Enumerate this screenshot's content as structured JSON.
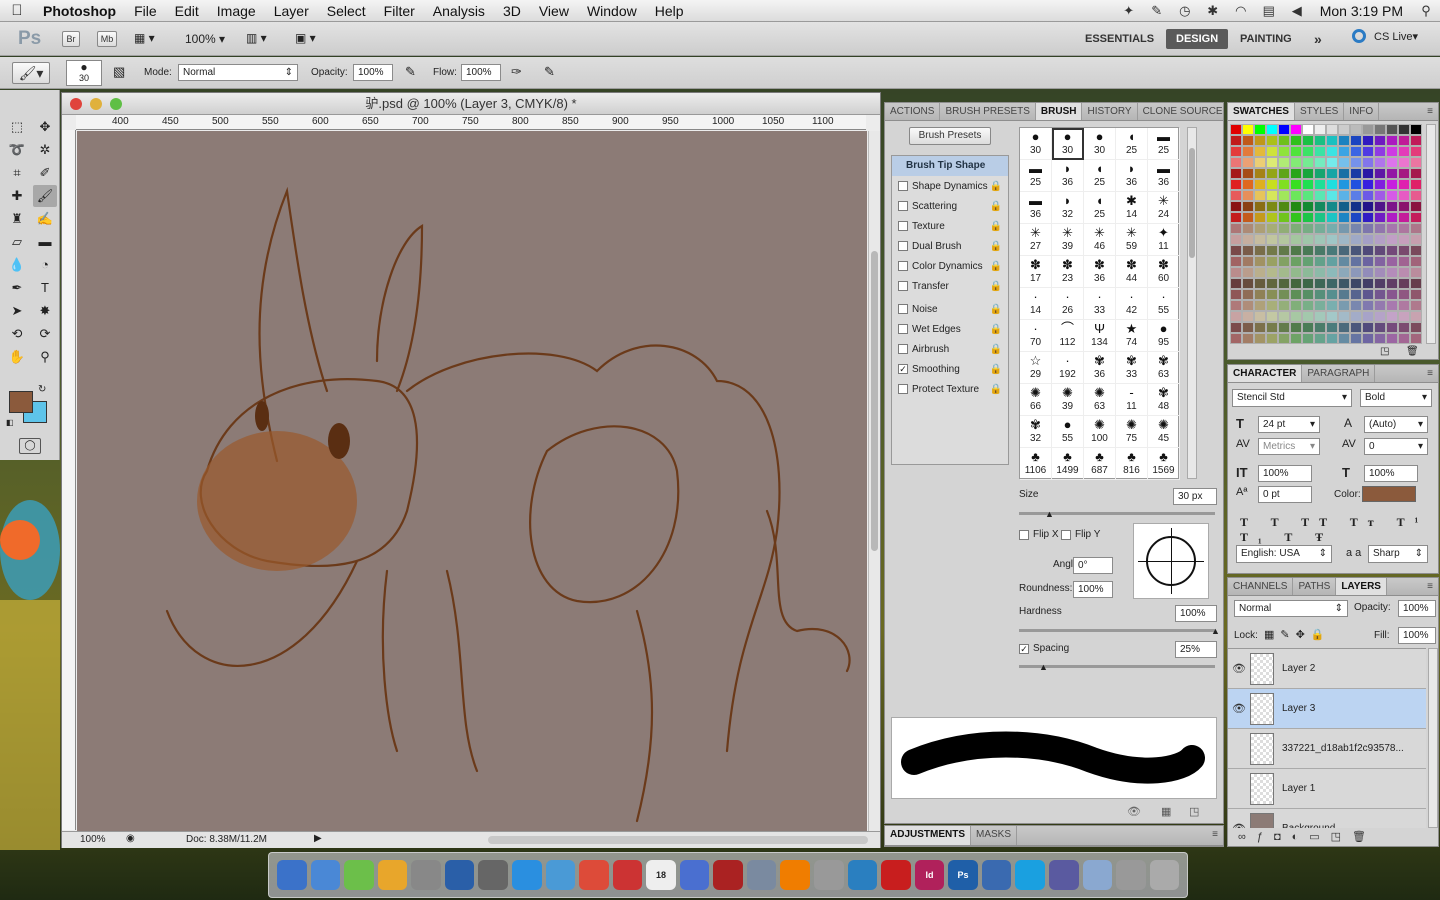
{
  "menubar": {
    "app": "Photoshop",
    "items": [
      "File",
      "Edit",
      "Image",
      "Layer",
      "Select",
      "Filter",
      "Analysis",
      "3D",
      "View",
      "Window",
      "Help"
    ],
    "clock": "Mon 3:19 PM"
  },
  "appbar": {
    "logo": "Ps",
    "br": "Br",
    "mb": "Mb",
    "zoom": "100%",
    "workspaces": [
      "ESSENTIALS",
      "DESIGN",
      "PAINTING"
    ],
    "more": "»",
    "cslive": "CS Live"
  },
  "options": {
    "brush_size": "30",
    "mode_label": "Mode:",
    "mode_value": "Normal",
    "opacity_label": "Opacity:",
    "opacity_value": "100%",
    "flow_label": "Flow:",
    "flow_value": "100%"
  },
  "document": {
    "title": "驴.psd @ 100% (Layer 3, CMYK/8) *",
    "ruler_ticks": [
      "400",
      "450",
      "500",
      "550",
      "600",
      "650",
      "700",
      "750",
      "800",
      "850",
      "900",
      "950",
      "1000",
      "1050",
      "1100"
    ],
    "zoom": "100%",
    "doc_size": "Doc: 8.38M/11.2M"
  },
  "brush_panel": {
    "tabs": [
      "ACTIONS",
      "BRUSH PRESETS",
      "BRUSH",
      "HISTORY",
      "CLONE SOURCE"
    ],
    "presets_button": "Brush Presets",
    "tip_shape": "Brush Tip Shape",
    "options": [
      {
        "label": "Shape Dynamics",
        "checked": false
      },
      {
        "label": "Scattering",
        "checked": false
      },
      {
        "label": "Texture",
        "checked": false
      },
      {
        "label": "Dual Brush",
        "checked": false
      },
      {
        "label": "Color Dynamics",
        "checked": false
      },
      {
        "label": "Transfer",
        "checked": false
      },
      {
        "label": "Noise",
        "checked": false
      },
      {
        "label": "Wet Edges",
        "checked": false
      },
      {
        "label": "Airbrush",
        "checked": false
      },
      {
        "label": "Smoothing",
        "checked": true
      },
      {
        "label": "Protect Texture",
        "checked": false
      }
    ],
    "tips": [
      "30",
      "30",
      "30",
      "25",
      "25",
      "25",
      "36",
      "25",
      "36",
      "36",
      "36",
      "32",
      "25",
      "14",
      "24",
      "27",
      "39",
      "46",
      "59",
      "11",
      "17",
      "23",
      "36",
      "44",
      "60",
      "14",
      "26",
      "33",
      "42",
      "55",
      "70",
      "112",
      "134",
      "74",
      "95",
      "29",
      "192",
      "36",
      "33",
      "63",
      "66",
      "39",
      "63",
      "11",
      "48",
      "32",
      "55",
      "100",
      "75",
      "45",
      "1106",
      "1499",
      "687",
      "816",
      "1569"
    ],
    "size_label": "Size",
    "size_value": "30 px",
    "flipx": "Flip X",
    "flipy": "Flip Y",
    "angle_label": "Angle:",
    "angle_value": "0°",
    "roundness_label": "Roundness:",
    "roundness_value": "100%",
    "hardness_label": "Hardness",
    "hardness_value": "100%",
    "spacing_label": "Spacing",
    "spacing_value": "25%",
    "bottom_tabs": [
      "ADJUSTMENTS",
      "MASKS"
    ]
  },
  "swatch_panel": {
    "tabs": [
      "SWATCHES",
      "STYLES",
      "INFO"
    ]
  },
  "character_panel": {
    "tabs": [
      "CHARACTER",
      "PARAGRAPH"
    ],
    "font": "Stencil Std",
    "style": "Bold",
    "size": "24 pt",
    "leading": "(Auto)",
    "kerning": "Metrics",
    "tracking": "0",
    "vscale": "100%",
    "hscale": "100%",
    "baseline": "0 pt",
    "color_label": "Color:",
    "language": "English: USA",
    "aa_label": "a a",
    "antialias": "Sharp",
    "text_color": "#8b5a3c"
  },
  "layers_panel": {
    "tabs": [
      "CHANNELS",
      "PATHS",
      "LAYERS"
    ],
    "blend": "Normal",
    "opacity_label": "Opacity:",
    "opacity": "100%",
    "lock_label": "Lock:",
    "fill_label": "Fill:",
    "fill": "100%",
    "layers": [
      {
        "name": "Layer 2",
        "visible": true,
        "active": false
      },
      {
        "name": "Layer 3",
        "visible": true,
        "active": true
      },
      {
        "name": "337221_d18ab1f2c93578...",
        "visible": false,
        "active": false
      },
      {
        "name": "Layer 1",
        "visible": false,
        "active": false
      },
      {
        "name": "Background",
        "visible": true,
        "active": false
      }
    ]
  },
  "colors": {
    "foreground": "#8b5a3c",
    "background": "#5ec4ea",
    "canvas": "#8c7b76",
    "line": "#6b3a1a"
  },
  "dock": {
    "icons": [
      "finder-icon",
      "dashboard-icon",
      "3d-icon",
      "scripts-icon",
      "rocket-icon",
      "sp-icon",
      "app-icon",
      "appstore-icon",
      "safari-icon",
      "chrome-icon",
      "ftp-icon",
      "calendar-icon",
      "itunes-icon",
      "photo-booth-icon",
      "iphoto-icon",
      "vlc-icon",
      "utility-icon",
      "sync-icon",
      "acrobat-icon",
      "indesign-icon",
      "photoshop-icon",
      "bridge-icon",
      "skype-icon",
      "keyboard-icon",
      "folder-icon",
      "reader-icon",
      "trash-icon"
    ],
    "calendar_day": "18",
    "id_label": "Id",
    "ps_label": "Ps"
  }
}
